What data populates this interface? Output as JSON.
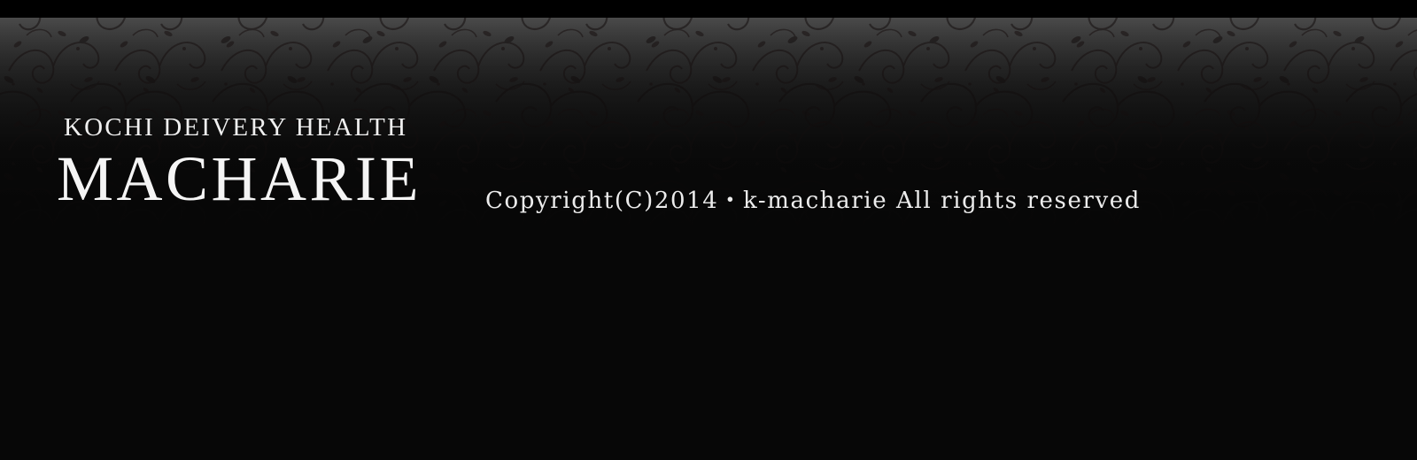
{
  "header": {
    "subtitle": "KOCHI DEIVERY HEALTH",
    "brand_name": "MACHARIE"
  },
  "footer": {
    "copyright": "Copyright(C)2014・k-macharie All rights reserved"
  },
  "colors": {
    "background": "#070707",
    "text": "#f2f2f2",
    "pattern": "#3a3a3a"
  },
  "icons": {
    "background_pattern": "damask-floral-pattern"
  }
}
